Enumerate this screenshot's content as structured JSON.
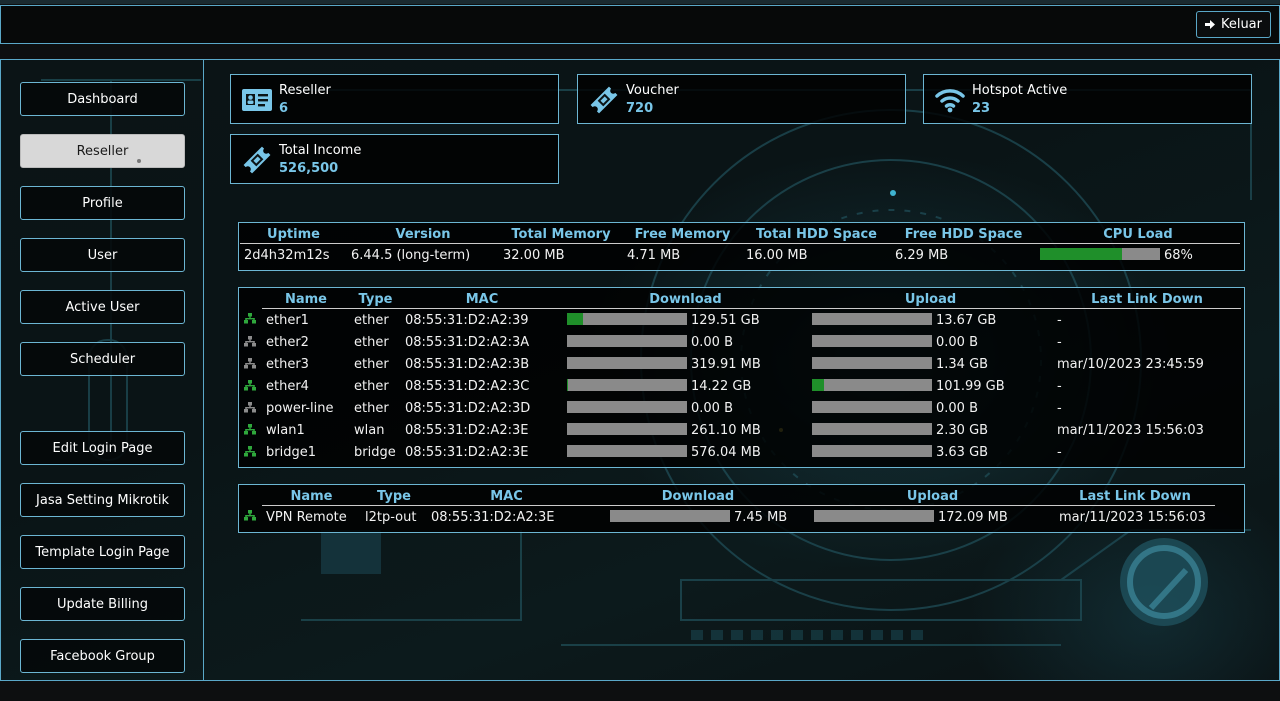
{
  "header": {
    "logout_label": "Keluar"
  },
  "sidebar": {
    "items": [
      {
        "label": "Dashboard"
      },
      {
        "label": "Reseller",
        "active": true
      },
      {
        "label": "Profile"
      },
      {
        "label": "User"
      },
      {
        "label": "Active User"
      },
      {
        "label": "Scheduler"
      },
      {
        "label": "Edit Login Page"
      },
      {
        "label": "Jasa Setting Mikrotik"
      },
      {
        "label": "Template Login Page"
      },
      {
        "label": "Update Billing"
      },
      {
        "label": "Facebook Group"
      }
    ]
  },
  "stats": {
    "reseller": {
      "label": "Reseller",
      "value": "6",
      "icon": "id-card-icon"
    },
    "voucher": {
      "label": "Voucher",
      "value": "720",
      "icon": "ticket-icon"
    },
    "hotspot": {
      "label": "Hotspot Active",
      "value": "23",
      "icon": "wifi-icon"
    },
    "income": {
      "label": "Total Income",
      "value": "526,500",
      "icon": "ticket-icon"
    }
  },
  "system": {
    "headers": [
      "Uptime",
      "Version",
      "Total Memory",
      "Free Memory",
      "Total HDD Space",
      "Free HDD Space",
      "CPU Load"
    ],
    "uptime": "2d4h32m12s",
    "version": "6.44.5 (long-term)",
    "total_memory": "32.00 MB",
    "free_memory": "4.71 MB",
    "total_hdd": "16.00 MB",
    "free_hdd": "6.29 MB",
    "cpu_load": "68%",
    "cpu_load_fraction": 0.68
  },
  "interfaces": {
    "headers": [
      "Name",
      "Type",
      "MAC",
      "Download",
      "Upload",
      "Last Link Down"
    ],
    "rows": [
      {
        "status": "up",
        "name": "ether1",
        "type": "ether",
        "mac": "08:55:31:D2:A2:39",
        "download": "129.51 GB",
        "download_fill": 0.13,
        "upload": "13.67 GB",
        "upload_fill": 0,
        "last_link_down": "-"
      },
      {
        "status": "down",
        "name": "ether2",
        "type": "ether",
        "mac": "08:55:31:D2:A2:3A",
        "download": "0.00 B",
        "download_fill": 0,
        "upload": "0.00 B",
        "upload_fill": 0,
        "last_link_down": "-"
      },
      {
        "status": "down",
        "name": "ether3",
        "type": "ether",
        "mac": "08:55:31:D2:A2:3B",
        "download": "319.91 MB",
        "download_fill": 0,
        "upload": "1.34 GB",
        "upload_fill": 0,
        "last_link_down": "mar/10/2023 23:45:59"
      },
      {
        "status": "up",
        "name": "ether4",
        "type": "ether",
        "mac": "08:55:31:D2:A2:3C",
        "download": "14.22 GB",
        "download_fill": 0.01,
        "upload": "101.99 GB",
        "upload_fill": 0.1,
        "last_link_down": "-"
      },
      {
        "status": "down",
        "name": "power-line",
        "type": "ether",
        "mac": "08:55:31:D2:A2:3D",
        "download": "0.00 B",
        "download_fill": 0,
        "upload": "0.00 B",
        "upload_fill": 0,
        "last_link_down": "-"
      },
      {
        "status": "up",
        "name": "wlan1",
        "type": "wlan",
        "mac": "08:55:31:D2:A2:3E",
        "download": "261.10 MB",
        "download_fill": 0,
        "upload": "2.30 GB",
        "upload_fill": 0,
        "last_link_down": "mar/11/2023 15:56:03"
      },
      {
        "status": "up",
        "name": "bridge1",
        "type": "bridge",
        "mac": "08:55:31:D2:A2:3E",
        "download": "576.04 MB",
        "download_fill": 0,
        "upload": "3.63 GB",
        "upload_fill": 0,
        "last_link_down": "-"
      }
    ]
  },
  "vpn": {
    "headers": [
      "Name",
      "Type",
      "MAC",
      "Download",
      "Upload",
      "Last Link Down"
    ],
    "rows": [
      {
        "status": "up",
        "name": "VPN Remote",
        "type": "l2tp-out",
        "mac": "08:55:31:D2:A2:3E",
        "download": "7.45 MB",
        "download_fill": 0,
        "upload": "172.09 MB",
        "upload_fill": 0,
        "last_link_down": "mar/11/2023 15:56:03"
      }
    ]
  },
  "colors": {
    "accent": "#79c6e8",
    "border": "#6cb6d3",
    "bar_fill": "#1f8f2a",
    "bar_bg": "#8a8a8a",
    "status_up": "#2fa83c",
    "status_down": "#8c8c8c"
  }
}
